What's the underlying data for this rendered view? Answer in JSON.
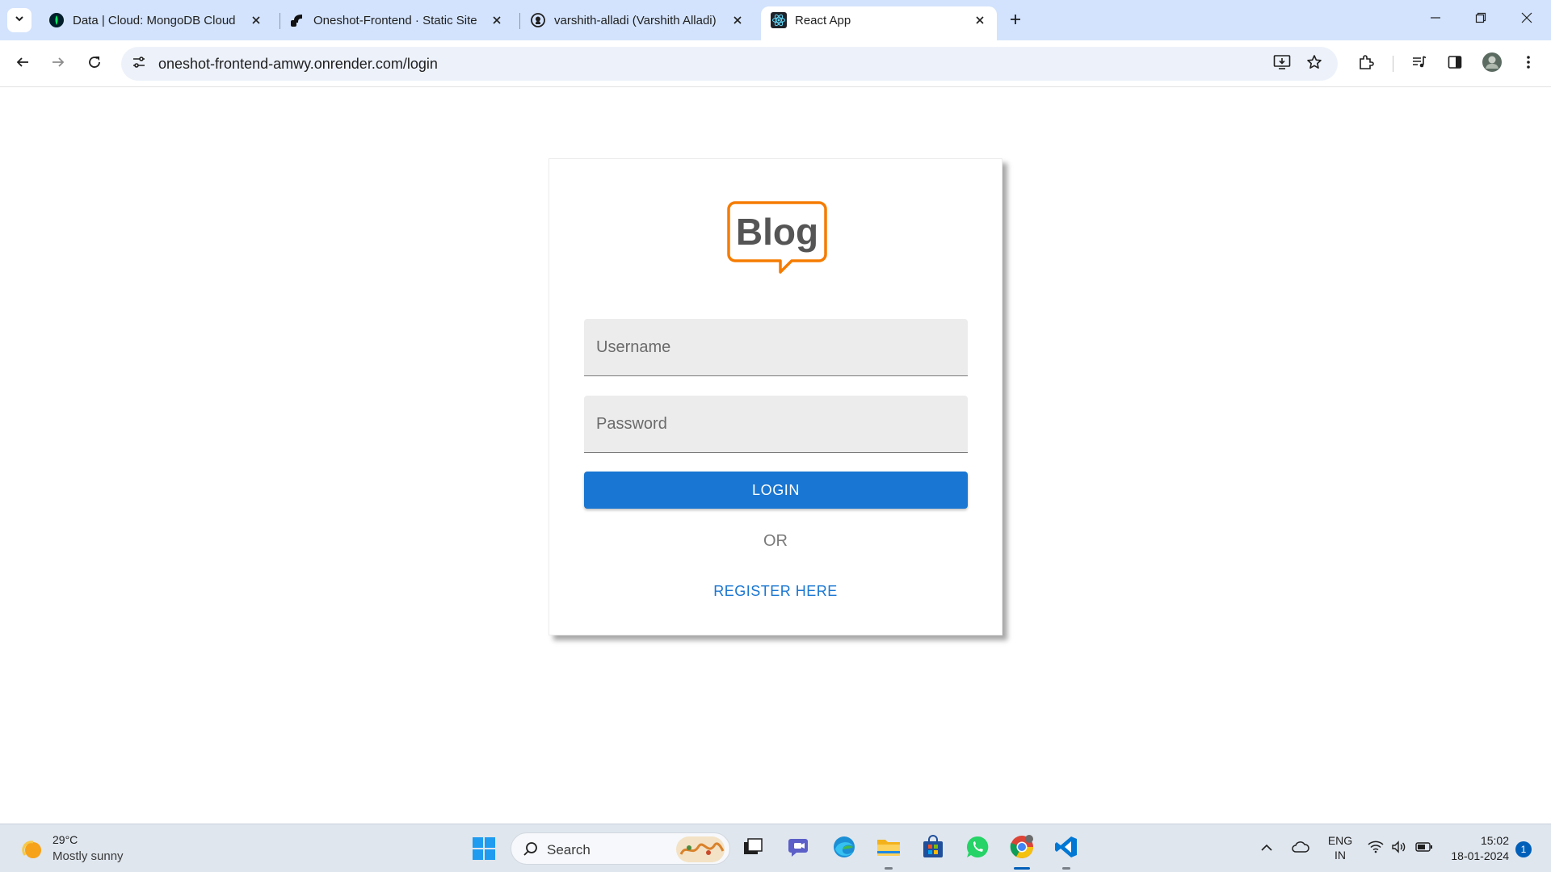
{
  "browser": {
    "tabs": [
      {
        "title": "Data | Cloud: MongoDB Cloud",
        "icon": "mongodb-icon"
      },
      {
        "title": "Oneshot-Frontend · Static Site",
        "icon": "render-icon"
      },
      {
        "title": "varshith-alladi (Varshith Alladi)",
        "icon": "github-icon"
      },
      {
        "title": "React App",
        "icon": "react-icon",
        "active": true
      }
    ],
    "url": "oneshot-frontend-amwy.onrender.com/login"
  },
  "login": {
    "logo_text": "Blog",
    "username_placeholder": "Username",
    "password_placeholder": "Password",
    "login_label": "LOGIN",
    "or_text": "OR",
    "register_label": "REGISTER HERE"
  },
  "taskbar": {
    "weather_temp": "29°C",
    "weather_desc": "Mostly sunny",
    "search_placeholder": "Search",
    "lang_line1": "ENG",
    "lang_line2": "IN",
    "time": "15:02",
    "date": "18-01-2024",
    "notification_count": "1"
  },
  "colors": {
    "primary": "#1976d2",
    "logo_orange": "#f57c00",
    "tabstrip": "#d3e3fd"
  }
}
